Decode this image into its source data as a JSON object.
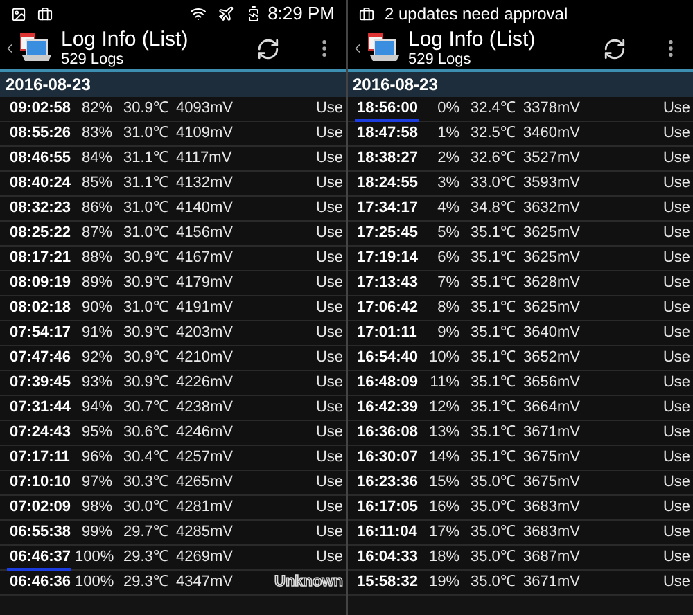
{
  "panels": [
    {
      "status_bar": {
        "time": "8:29 PM"
      },
      "header": {
        "title": "Log Info (List)",
        "subtitle": "529 Logs"
      },
      "date": "2016-08-23",
      "rows": [
        {
          "time": "09:02:58",
          "percent": "82%",
          "temp": "30.9℃",
          "voltage": "4093mV",
          "status": "Use",
          "kind": "plain",
          "marked": false
        },
        {
          "time": "08:55:26",
          "percent": "83%",
          "temp": "31.0℃",
          "voltage": "4109mV",
          "status": "Use",
          "kind": "plain",
          "marked": false
        },
        {
          "time": "08:46:55",
          "percent": "84%",
          "temp": "31.1℃",
          "voltage": "4117mV",
          "status": "Use",
          "kind": "plain",
          "marked": false
        },
        {
          "time": "08:40:24",
          "percent": "85%",
          "temp": "31.1℃",
          "voltage": "4132mV",
          "status": "Use",
          "kind": "plain",
          "marked": false
        },
        {
          "time": "08:32:23",
          "percent": "86%",
          "temp": "31.0℃",
          "voltage": "4140mV",
          "status": "Use",
          "kind": "plain",
          "marked": false
        },
        {
          "time": "08:25:22",
          "percent": "87%",
          "temp": "31.0℃",
          "voltage": "4156mV",
          "status": "Use",
          "kind": "plain",
          "marked": false
        },
        {
          "time": "08:17:21",
          "percent": "88%",
          "temp": "30.9℃",
          "voltage": "4167mV",
          "status": "Use",
          "kind": "plain",
          "marked": false
        },
        {
          "time": "08:09:19",
          "percent": "89%",
          "temp": "30.9℃",
          "voltage": "4179mV",
          "status": "Use",
          "kind": "plain",
          "marked": false
        },
        {
          "time": "08:02:18",
          "percent": "90%",
          "temp": "31.0℃",
          "voltage": "4191mV",
          "status": "Use",
          "kind": "plain",
          "marked": false
        },
        {
          "time": "07:54:17",
          "percent": "91%",
          "temp": "30.9℃",
          "voltage": "4203mV",
          "status": "Use",
          "kind": "plain",
          "marked": false
        },
        {
          "time": "07:47:46",
          "percent": "92%",
          "temp": "30.9℃",
          "voltage": "4210mV",
          "status": "Use",
          "kind": "plain",
          "marked": false
        },
        {
          "time": "07:39:45",
          "percent": "93%",
          "temp": "30.9℃",
          "voltage": "4226mV",
          "status": "Use",
          "kind": "plain",
          "marked": false
        },
        {
          "time": "07:31:44",
          "percent": "94%",
          "temp": "30.7℃",
          "voltage": "4238mV",
          "status": "Use",
          "kind": "plain",
          "marked": false
        },
        {
          "time": "07:24:43",
          "percent": "95%",
          "temp": "30.6℃",
          "voltage": "4246mV",
          "status": "Use",
          "kind": "plain",
          "marked": false
        },
        {
          "time": "07:17:11",
          "percent": "96%",
          "temp": "30.4℃",
          "voltage": "4257mV",
          "status": "Use",
          "kind": "plain",
          "marked": false
        },
        {
          "time": "07:10:10",
          "percent": "97%",
          "temp": "30.3℃",
          "voltage": "4265mV",
          "status": "Use",
          "kind": "plain",
          "marked": false
        },
        {
          "time": "07:02:09",
          "percent": "98%",
          "temp": "30.0℃",
          "voltage": "4281mV",
          "status": "Use",
          "kind": "plain",
          "marked": false
        },
        {
          "time": "06:55:38",
          "percent": "99%",
          "temp": "29.7℃",
          "voltage": "4285mV",
          "status": "Use",
          "kind": "plain",
          "marked": false
        },
        {
          "time": "06:46:37",
          "percent": "100%",
          "temp": "29.3℃",
          "voltage": "4269mV",
          "status": "Use",
          "kind": "plain",
          "marked": true
        },
        {
          "time": "06:46:36",
          "percent": "100%",
          "temp": "29.3℃",
          "voltage": "4347mV",
          "status": "Unknown",
          "kind": "outline",
          "marked": false
        }
      ]
    },
    {
      "status_bar": {
        "notice": "2 updates need approval"
      },
      "header": {
        "title": "Log Info (List)",
        "subtitle": "529 Logs"
      },
      "date": "2016-08-23",
      "rows": [
        {
          "time": "18:56:00",
          "percent": "0%",
          "temp": "32.4℃",
          "voltage": "3378mV",
          "status": "Use",
          "kind": "plain",
          "marked": true
        },
        {
          "time": "18:47:58",
          "percent": "1%",
          "temp": "32.5℃",
          "voltage": "3460mV",
          "status": "Use",
          "kind": "plain",
          "marked": false
        },
        {
          "time": "18:38:27",
          "percent": "2%",
          "temp": "32.6℃",
          "voltage": "3527mV",
          "status": "Use",
          "kind": "plain",
          "marked": false
        },
        {
          "time": "18:24:55",
          "percent": "3%",
          "temp": "33.0℃",
          "voltage": "3593mV",
          "status": "Use",
          "kind": "plain",
          "marked": false
        },
        {
          "time": "17:34:17",
          "percent": "4%",
          "temp": "34.8℃",
          "voltage": "3632mV",
          "status": "Use",
          "kind": "plain",
          "marked": false
        },
        {
          "time": "17:25:45",
          "percent": "5%",
          "temp": "35.1℃",
          "voltage": "3625mV",
          "status": "Use",
          "kind": "plain",
          "marked": false
        },
        {
          "time": "17:19:14",
          "percent": "6%",
          "temp": "35.1℃",
          "voltage": "3625mV",
          "status": "Use",
          "kind": "plain",
          "marked": false
        },
        {
          "time": "17:13:43",
          "percent": "7%",
          "temp": "35.1℃",
          "voltage": "3628mV",
          "status": "Use",
          "kind": "plain",
          "marked": false
        },
        {
          "time": "17:06:42",
          "percent": "8%",
          "temp": "35.1℃",
          "voltage": "3625mV",
          "status": "Use",
          "kind": "plain",
          "marked": false
        },
        {
          "time": "17:01:11",
          "percent": "9%",
          "temp": "35.1℃",
          "voltage": "3640mV",
          "status": "Use",
          "kind": "plain",
          "marked": false
        },
        {
          "time": "16:54:40",
          "percent": "10%",
          "temp": "35.1℃",
          "voltage": "3652mV",
          "status": "Use",
          "kind": "plain",
          "marked": false
        },
        {
          "time": "16:48:09",
          "percent": "11%",
          "temp": "35.1℃",
          "voltage": "3656mV",
          "status": "Use",
          "kind": "plain",
          "marked": false
        },
        {
          "time": "16:42:39",
          "percent": "12%",
          "temp": "35.1℃",
          "voltage": "3664mV",
          "status": "Use",
          "kind": "plain",
          "marked": false
        },
        {
          "time": "16:36:08",
          "percent": "13%",
          "temp": "35.1℃",
          "voltage": "3671mV",
          "status": "Use",
          "kind": "plain",
          "marked": false
        },
        {
          "time": "16:30:07",
          "percent": "14%",
          "temp": "35.1℃",
          "voltage": "3675mV",
          "status": "Use",
          "kind": "plain",
          "marked": false
        },
        {
          "time": "16:23:36",
          "percent": "15%",
          "temp": "35.0℃",
          "voltage": "3675mV",
          "status": "Use",
          "kind": "plain",
          "marked": false
        },
        {
          "time": "16:17:05",
          "percent": "16%",
          "temp": "35.0℃",
          "voltage": "3683mV",
          "status": "Use",
          "kind": "plain",
          "marked": false
        },
        {
          "time": "16:11:04",
          "percent": "17%",
          "temp": "35.0℃",
          "voltage": "3683mV",
          "status": "Use",
          "kind": "plain",
          "marked": false
        },
        {
          "time": "16:04:33",
          "percent": "18%",
          "temp": "35.0℃",
          "voltage": "3687mV",
          "status": "Use",
          "kind": "plain",
          "marked": false
        },
        {
          "time": "15:58:32",
          "percent": "19%",
          "temp": "35.0℃",
          "voltage": "3671mV",
          "status": "Use",
          "kind": "plain",
          "marked": false
        }
      ]
    }
  ]
}
